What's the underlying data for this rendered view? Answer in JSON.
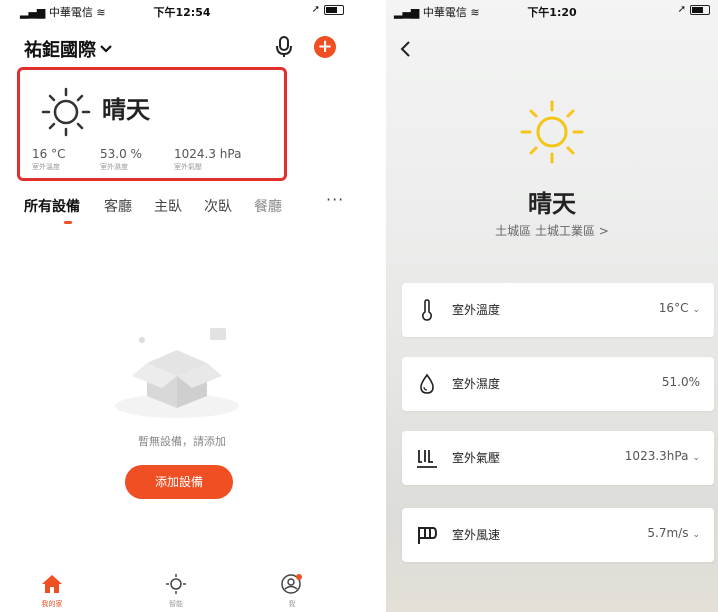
{
  "left": {
    "status": {
      "carrier": "中華電信",
      "time": "下午12:54"
    },
    "home_title": "祐鉅國際",
    "weather": {
      "condition": "晴天",
      "temp_value": "16 °C",
      "temp_label": "室外溫度",
      "humidity_value": "53.0 %",
      "humidity_label": "室外濕度",
      "pressure_value": "1024.3 hPa",
      "pressure_label": "室外氣壓"
    },
    "tabs": [
      "所有設備",
      "客廳",
      "主臥",
      "次臥",
      "餐廳"
    ],
    "tab_more": "···",
    "empty_text": "暫無設備，請添加",
    "add_device_label": "添加設備",
    "nav": [
      {
        "label": "我的家",
        "icon": "home-icon",
        "active": true
      },
      {
        "label": "智能",
        "icon": "smart-icon",
        "active": false
      },
      {
        "label": "我",
        "icon": "profile-icon",
        "active": false
      }
    ],
    "accent": "#f04e23",
    "highlight": "#e0312f"
  },
  "right": {
    "status": {
      "carrier": "中華電信",
      "time": "下午1:20"
    },
    "condition": "晴天",
    "location": "土城區 土城工業區 >",
    "cards": [
      {
        "name": "室外溫度",
        "value": "16°C",
        "chevron": "⌄",
        "icon": "thermometer-icon"
      },
      {
        "name": "室外濕度",
        "value": "51.0%",
        "chevron": "",
        "icon": "water-drop-icon"
      },
      {
        "name": "室外氣壓",
        "value": "1023.3hPa",
        "chevron": "⌄",
        "icon": "pressure-icon"
      },
      {
        "name": "室外風速",
        "value": "5.7m/s",
        "chevron": "⌄",
        "icon": "wind-flag-icon"
      }
    ],
    "sun_color": "#f5c518"
  }
}
